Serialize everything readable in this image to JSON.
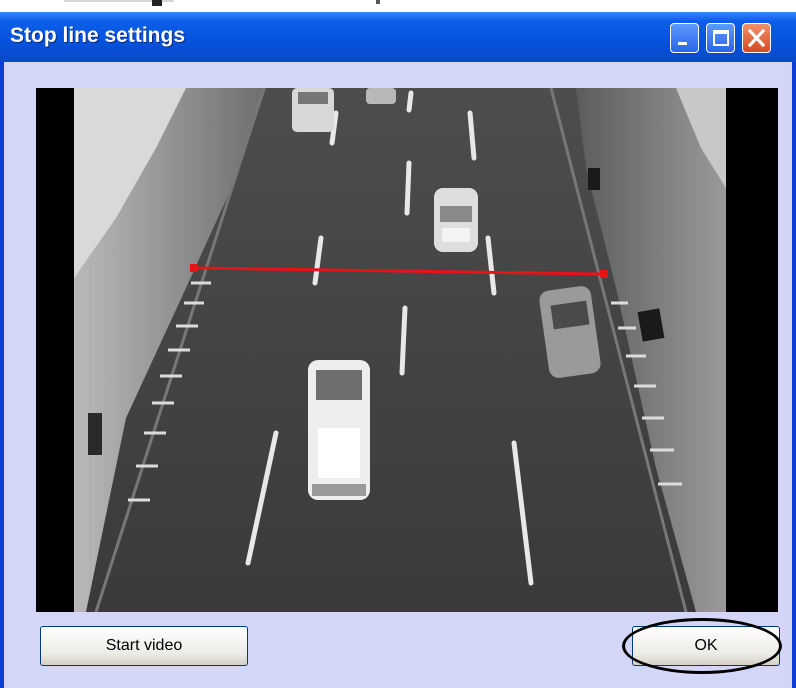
{
  "window": {
    "title": "Stop line settings",
    "controls": {
      "minimize_icon": "minimize-icon",
      "maximize_icon": "maximize-icon",
      "close_icon": "close-icon"
    }
  },
  "video": {
    "content": "traffic-camera-frame",
    "stop_line_color": "#e8131a"
  },
  "buttons": {
    "start_video": "Start video",
    "ok": "OK"
  },
  "colors": {
    "title_bar": "#0752dc",
    "client_bg": "#d3d6f6",
    "close_button": "#d54a1f"
  }
}
